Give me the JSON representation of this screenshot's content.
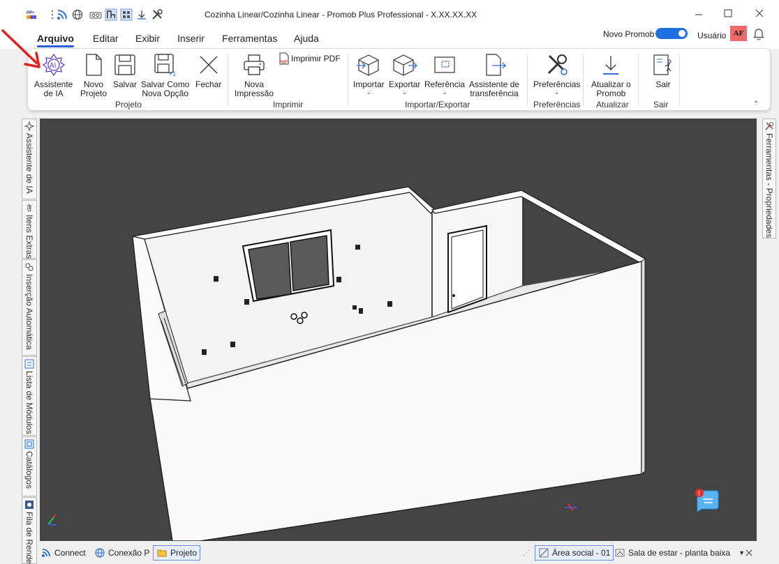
{
  "window": {
    "title": "Cozinha Linear/Cozinha Linear - Promob Plus Professional - X.XX.XX.XX",
    "app_badge": "PP+"
  },
  "menu": {
    "tabs": [
      "Arquivo",
      "Editar",
      "Exibir",
      "Inserir",
      "Ferramentas",
      "Ajuda"
    ],
    "active": "Arquivo"
  },
  "account": {
    "novo_promob_label": "Novo Promob",
    "novo_promob_on": true,
    "user_label": "Usuário",
    "avatar_initials": "AF"
  },
  "ribbon": {
    "buttons": {
      "ai": "Assistente\nde IA",
      "new": "Novo\nProjeto",
      "save": "Salvar",
      "save_as": "Salvar Como\nNova Opção",
      "close": "Fechar",
      "new_print": "Nova\nImpressão",
      "print_pdf": "Imprimir PDF",
      "import": "Importar",
      "export": "Exportar",
      "reference": "Referência",
      "transfer": "Assistente de\ntransferência",
      "preferences": "Preferências",
      "update": "Atualizar o\nPromob",
      "exit": "Sair"
    },
    "groups": {
      "projeto": "Projeto",
      "imprimir": "Imprimir",
      "importar_exportar": "Importar/Exportar",
      "preferencias": "Preferências",
      "atualizar": "Atualizar",
      "sair": "Sair"
    }
  },
  "left_tabs": [
    "Assistente de IA",
    "Itens Extras",
    "Inserção Automática",
    "Lista de Módulos",
    "Catálogos",
    "Fila de Render"
  ],
  "right_tabs": [
    "Ferramentas - Propriedades"
  ],
  "statusbar": {
    "connect": "Connect",
    "conexao": "Conexão P",
    "projeto": "Projeto",
    "area": "Área social - 01",
    "view": "Sala de estar - planta baixa"
  },
  "colors": {
    "accent": "#1f6fe0",
    "viewport_bg": "#444444",
    "avatar_bg": "#ef6b6b",
    "annotation_arrow": "#e0201e"
  }
}
